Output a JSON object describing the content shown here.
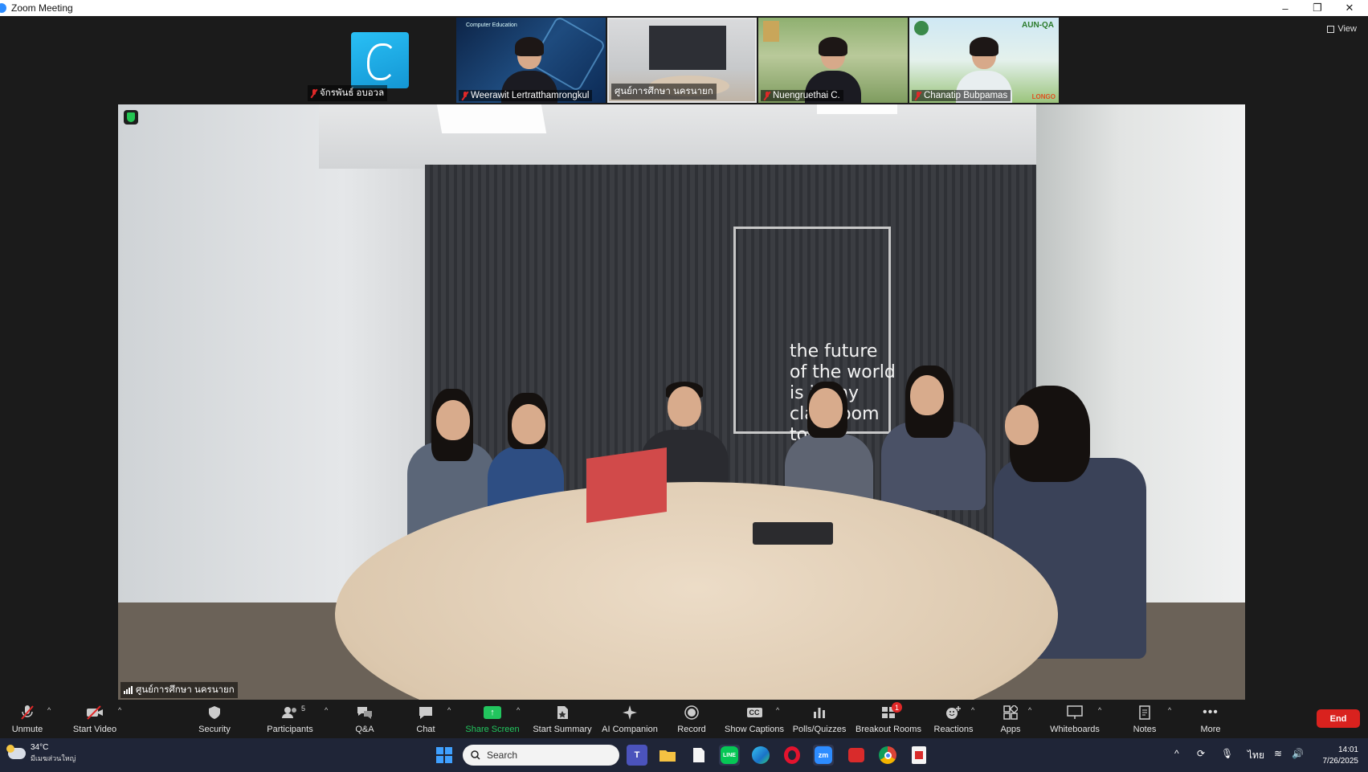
{
  "window": {
    "title": "Zoom Meeting",
    "controls": {
      "minimize": "–",
      "restore": "❐",
      "close": "✕"
    }
  },
  "view_button": {
    "label": "View"
  },
  "thumbnails": [
    {
      "name": "จักรพันธ์ อบอวล",
      "muted": true
    },
    {
      "name": "Weerawit Lertratthamrongkul",
      "muted": true,
      "header": "Computer Education"
    },
    {
      "name": "ศูนย์การศึกษา นครนายก",
      "muted": false
    },
    {
      "name": "Nuengruethai C.",
      "muted": true
    },
    {
      "name": "Chanatip Bubpamas",
      "muted": true,
      "tag": "AUN-QA",
      "corner_text": "LONGO"
    }
  ],
  "main_video": {
    "label": "ศูนย์การศึกษา นครนายก",
    "wall_text": [
      "the future",
      "of the world",
      "is in my",
      "classroom",
      "today"
    ]
  },
  "toolbar": {
    "unmute": "Unmute",
    "start_video": "Start Video",
    "security": "Security",
    "participants": "Participants",
    "participants_count": "5",
    "qa": "Q&A",
    "chat": "Chat",
    "share_screen": "Share Screen",
    "start_summary": "Start Summary",
    "ai_companion": "AI Companion",
    "record": "Record",
    "show_captions": "Show Captions",
    "captions_icon": "CC",
    "polls": "Polls/Quizzes",
    "breakout_rooms": "Breakout Rooms",
    "breakout_badge": "1",
    "reactions": "Reactions",
    "apps": "Apps",
    "whiteboards": "Whiteboards",
    "notes": "Notes",
    "more": "More",
    "end": "End"
  },
  "taskbar": {
    "weather_temp": "34°C",
    "weather_condition": "มีเมฆส่วนใหญ่",
    "search_placeholder": "Search",
    "language": "ไทย",
    "time": "14:01",
    "date": "7/26/2025"
  },
  "colors": {
    "accent_green": "#22c55e",
    "end_red": "#d9221e",
    "taskbar_bg": "#1f2537"
  }
}
